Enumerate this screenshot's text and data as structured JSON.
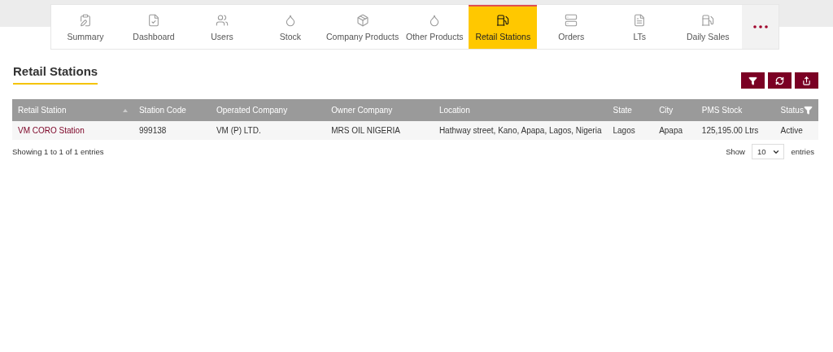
{
  "nav_tabs": [
    {
      "label": "Summary",
      "selected": false
    },
    {
      "label": "Dashboard",
      "selected": false
    },
    {
      "label": "Users",
      "selected": false
    },
    {
      "label": "Stock",
      "selected": false
    },
    {
      "label": "Company Products",
      "selected": false
    },
    {
      "label": "Other Products",
      "selected": false
    },
    {
      "label": "Retail Stations",
      "selected": true
    },
    {
      "label": "Orders",
      "selected": false
    },
    {
      "label": "LTs",
      "selected": false
    },
    {
      "label": "Daily Sales",
      "selected": false
    }
  ],
  "page_title": "Retail Stations",
  "table": {
    "columns": [
      "Retail Station",
      "Station Code",
      "Operated Company",
      "Owner Company",
      "Location",
      "State",
      "City",
      "PMS Stock",
      "Status"
    ],
    "rows": [
      [
        "VM CORO Station",
        "999138",
        "VM (P) LTD.",
        "MRS OIL NIGERIA",
        "Hathway street, Kano, Apapa, Lagos, Nigeria",
        "Lagos",
        "Apapa",
        "125,195.00 Ltrs",
        "Active"
      ]
    ]
  },
  "footer": {
    "info": "Showing 1 to 1 of 1 entries",
    "show_label": "Show",
    "page_size": "10",
    "entries_label": "entries"
  }
}
